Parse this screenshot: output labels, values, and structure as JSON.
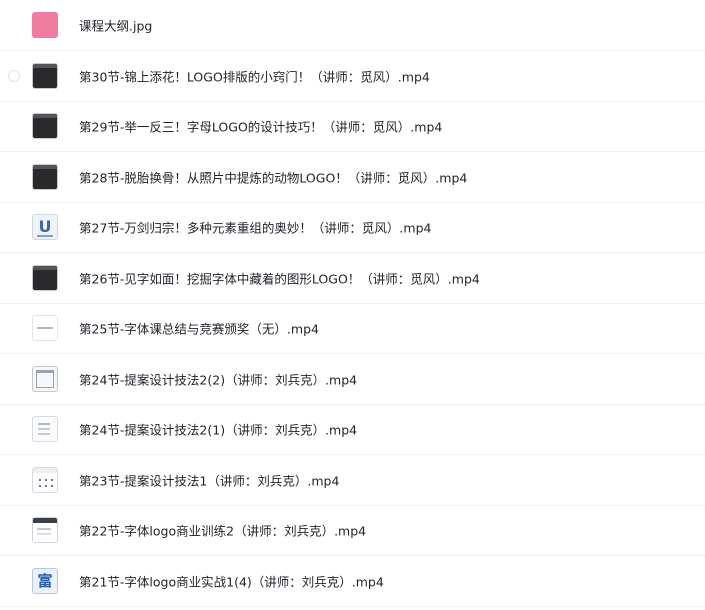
{
  "files": [
    {
      "name": "课程大纲.jpg",
      "thumb_icon": "pink-image-icon"
    },
    {
      "name": "第30节-锦上添花！LOGO排版的小窍门！（讲师：觅风）.mp4",
      "thumb_icon": "video-thumbnail-icon"
    },
    {
      "name": "第29节-举一反三！字母LOGO的设计技巧！（讲师：觅风）.mp4",
      "thumb_icon": "video-thumbnail-icon"
    },
    {
      "name": "第28节-脱胎换骨！从照片中提炼的动物LOGO！（讲师：觅风）.mp4",
      "thumb_icon": "video-thumbnail-icon"
    },
    {
      "name": "第27节-万剑归宗！多种元素重组的奥妙！（讲师：觅风）.mp4",
      "thumb_icon": "video-thumbnail-icon",
      "thumb_text": "U"
    },
    {
      "name": "第26节-见字如面！挖掘字体中藏着的图形LOGO！（讲师：觅风）.mp4",
      "thumb_icon": "video-thumbnail-icon"
    },
    {
      "name": "第25节-字体课总结与竞赛颁奖（无）.mp4",
      "thumb_icon": "video-thumbnail-icon"
    },
    {
      "name": "第24节-提案设计技法2(2)（讲师：刘兵克）.mp4",
      "thumb_icon": "video-thumbnail-icon"
    },
    {
      "name": "第24节-提案设计技法2(1)（讲师：刘兵克）.mp4",
      "thumb_icon": "video-thumbnail-icon"
    },
    {
      "name": "第23节-提案设计技法1（讲师：刘兵克）.mp4",
      "thumb_icon": "video-thumbnail-icon"
    },
    {
      "name": "第22节-字体logo商业训练2（讲师：刘兵克）.mp4",
      "thumb_icon": "video-thumbnail-icon"
    },
    {
      "name": "第21节-字体logo商业实战1(4)（讲师：刘兵克）.mp4",
      "thumb_icon": "video-thumbnail-icon",
      "thumb_text": "富"
    }
  ],
  "colors": {
    "text": "#1f2329",
    "divider": "#eef0f2",
    "pink_thumb": "#f07c9f",
    "dark_thumb": "#2a2a2d",
    "blue_accent": "#3d66b0"
  }
}
